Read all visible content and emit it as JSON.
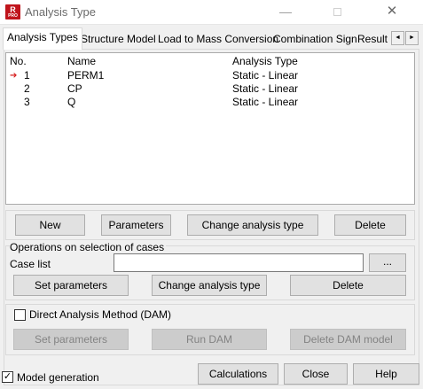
{
  "window": {
    "title": "Analysis Type",
    "app_icon_letter": "R",
    "app_icon_sub": "PRO",
    "minimize_glyph": "—",
    "close_glyph": "✕"
  },
  "tabs": [
    {
      "label": "Analysis Types",
      "active": true
    },
    {
      "label": "Structure Model"
    },
    {
      "label": "Load to Mass Conversion"
    },
    {
      "label": "Combination Sign"
    },
    {
      "label": "Result F"
    }
  ],
  "tab_scroll": {
    "left": "◄",
    "right": "►"
  },
  "list": {
    "columns": {
      "no": "No.",
      "name": "Name",
      "type": "Analysis Type"
    },
    "rows": [
      {
        "no": "1",
        "name": "PERM1",
        "type": "Static - Linear",
        "current": true
      },
      {
        "no": "2",
        "name": "CP",
        "type": "Static - Linear"
      },
      {
        "no": "3",
        "name": "Q",
        "type": "Static - Linear"
      }
    ],
    "current_marker": "➔"
  },
  "actions": {
    "new": "New",
    "parameters": "Parameters",
    "change_type": "Change analysis type",
    "delete": "Delete"
  },
  "operations": {
    "title": "Operations on selection of cases",
    "case_list_label": "Case list",
    "case_list_value": "",
    "browse": "...",
    "set_parameters": "Set parameters",
    "change_type": "Change analysis type",
    "delete": "Delete"
  },
  "dam": {
    "checkbox_label": "Direct Analysis Method (DAM)",
    "checked": false,
    "set_parameters": "Set parameters",
    "run": "Run DAM",
    "delete_model": "Delete DAM model"
  },
  "footer": {
    "model_generation_label": "Model generation",
    "model_generation_checked": true,
    "check_glyph": "✓",
    "calculations": "Calculations",
    "close": "Close",
    "help": "Help"
  }
}
